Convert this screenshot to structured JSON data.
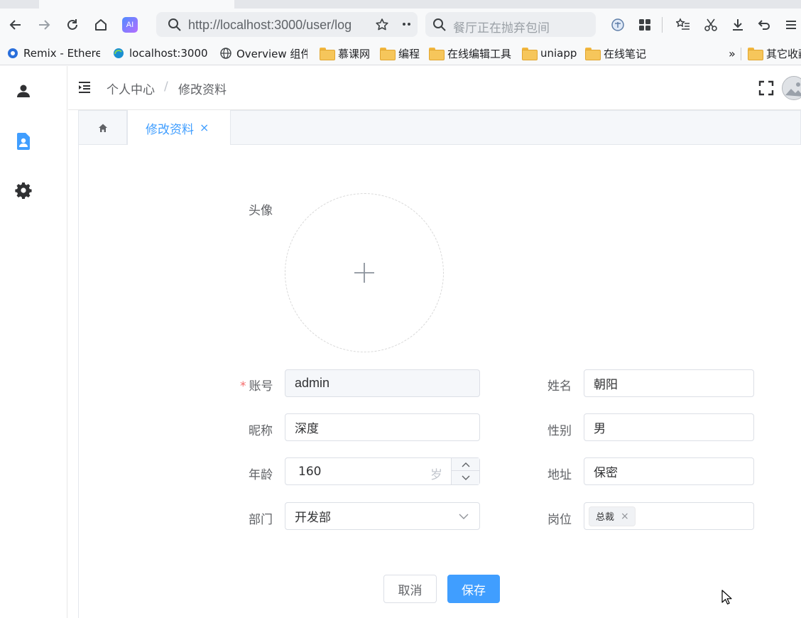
{
  "browser": {
    "url": "http://localhost:3000/user/log",
    "search_placeholder": "餐厅正在抛弃包间",
    "ai_label": "AI",
    "bookmarks": [
      {
        "label": "Remix - Ethere"
      },
      {
        "label": "localhost:3000/"
      },
      {
        "label": "Overview 组件"
      },
      {
        "label": "慕课网"
      },
      {
        "label": "编程"
      },
      {
        "label": "在线编辑工具"
      },
      {
        "label": "uniapp"
      },
      {
        "label": "在线笔记"
      }
    ],
    "overflow_label": "»",
    "other_bookmarks": "其它收藏"
  },
  "header": {
    "breadcrumb": [
      "个人中心",
      "修改资料"
    ],
    "separator": "/"
  },
  "tabs": {
    "active_label": "修改资料",
    "close_glyph": "×"
  },
  "form": {
    "avatar_label": "头像",
    "account": {
      "label": "账号",
      "value": "admin",
      "required_mark": "*"
    },
    "name": {
      "label": "姓名",
      "value": "朝阳"
    },
    "nickname": {
      "label": "昵称",
      "value": "深度"
    },
    "gender": {
      "label": "性别",
      "value": "男"
    },
    "age": {
      "label": "年龄",
      "value": "160",
      "unit": "岁"
    },
    "address": {
      "label": "地址",
      "value": "保密"
    },
    "department": {
      "label": "部门",
      "value": "开发部"
    },
    "position": {
      "label": "岗位",
      "tags": [
        "总裁"
      ]
    }
  },
  "actions": {
    "cancel": "取消",
    "save": "保存"
  },
  "colors": {
    "primary": "#409eff",
    "required": "#f56c6c"
  }
}
